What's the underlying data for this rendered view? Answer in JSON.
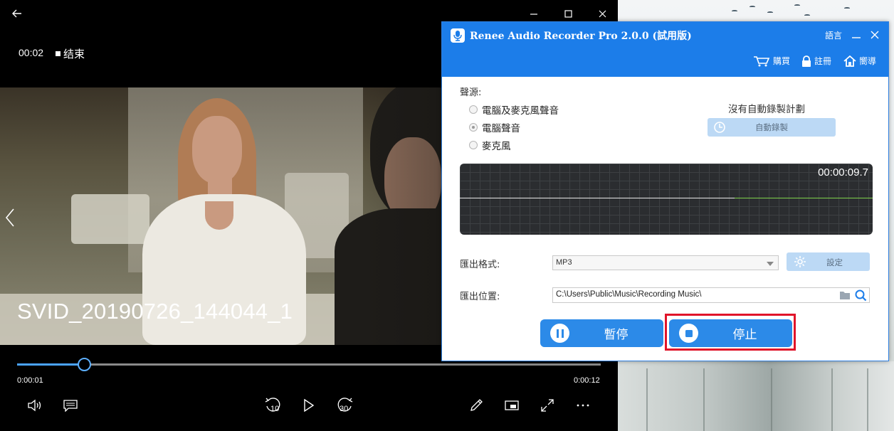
{
  "player": {
    "current_time": "00:02",
    "end_label": "结束",
    "video_title": "SVID_20190726_144044_1",
    "elapsed": "0:00:01",
    "duration": "0:00:12",
    "progress": 0.115,
    "icons": {
      "back": "back-arrow-icon",
      "minimize": "minimize-icon",
      "maximize": "maximize-icon",
      "close": "close-icon",
      "previous": "chevron-left-icon",
      "volume": "volume-icon",
      "subtitles": "subtitles-icon",
      "skip_back": "skip-back-10-icon",
      "play": "play-icon",
      "skip_forward": "skip-forward-30-icon",
      "edit": "pencil-icon",
      "mini_view": "mini-view-icon",
      "fullscreen": "fullscreen-icon",
      "more": "more-icon"
    },
    "skip_back_label": "10",
    "skip_forward_label": "30"
  },
  "recorder": {
    "title": "Renee Audio Recorder Pro 2.0.0 (試用版)",
    "language": "語言",
    "links": {
      "buy": "購買",
      "register": "註冊",
      "guide": "嚮導"
    },
    "source_label": "聲源:",
    "sources": [
      {
        "label": "電腦及麥克風聲音",
        "selected": false
      },
      {
        "label": "電腦聲音",
        "selected": true
      },
      {
        "label": "麥克風",
        "selected": false
      }
    ],
    "schedule_status": "沒有自動錄製計劃",
    "auto_record_button": "自動錄製",
    "timer": "00:00:09.7",
    "format_label": "匯出格式:",
    "format_value": "MP3",
    "settings_button": "設定",
    "location_label": "匯出位置:",
    "location_value": "C:\\Users\\Public\\Music\\Recording Music\\",
    "pause_button": "暫停",
    "stop_button": "停止",
    "colors": {
      "header": "#1c7de9",
      "button": "#2c8ae8",
      "light_button": "#bcd9f5",
      "wave_signal": "#7fd24b",
      "highlight": "#e0142a"
    }
  }
}
